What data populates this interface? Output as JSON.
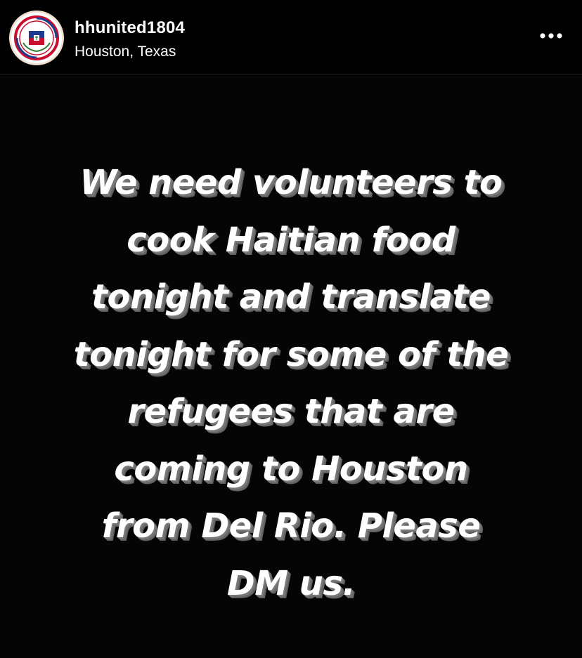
{
  "header": {
    "username": "hhunited1804",
    "location": "Houston, Texas",
    "avatar_icon": "hhunited-logo-icon",
    "more_icon": "more-options-icon"
  },
  "post": {
    "text": "We need volunteers to\ncook Haitian food\ntonight and translate\ntonight for some of the\nrefugees that are\ncoming to Houston\nfrom Del Rio. Please\nDM us."
  },
  "colors": {
    "background": "#000000",
    "text": "#ffffff",
    "text_shadow": "#6e6e6e",
    "avatar_ring": "#f0e0d0",
    "logo_red": "#c8102e",
    "logo_blue": "#1d3c8f"
  }
}
